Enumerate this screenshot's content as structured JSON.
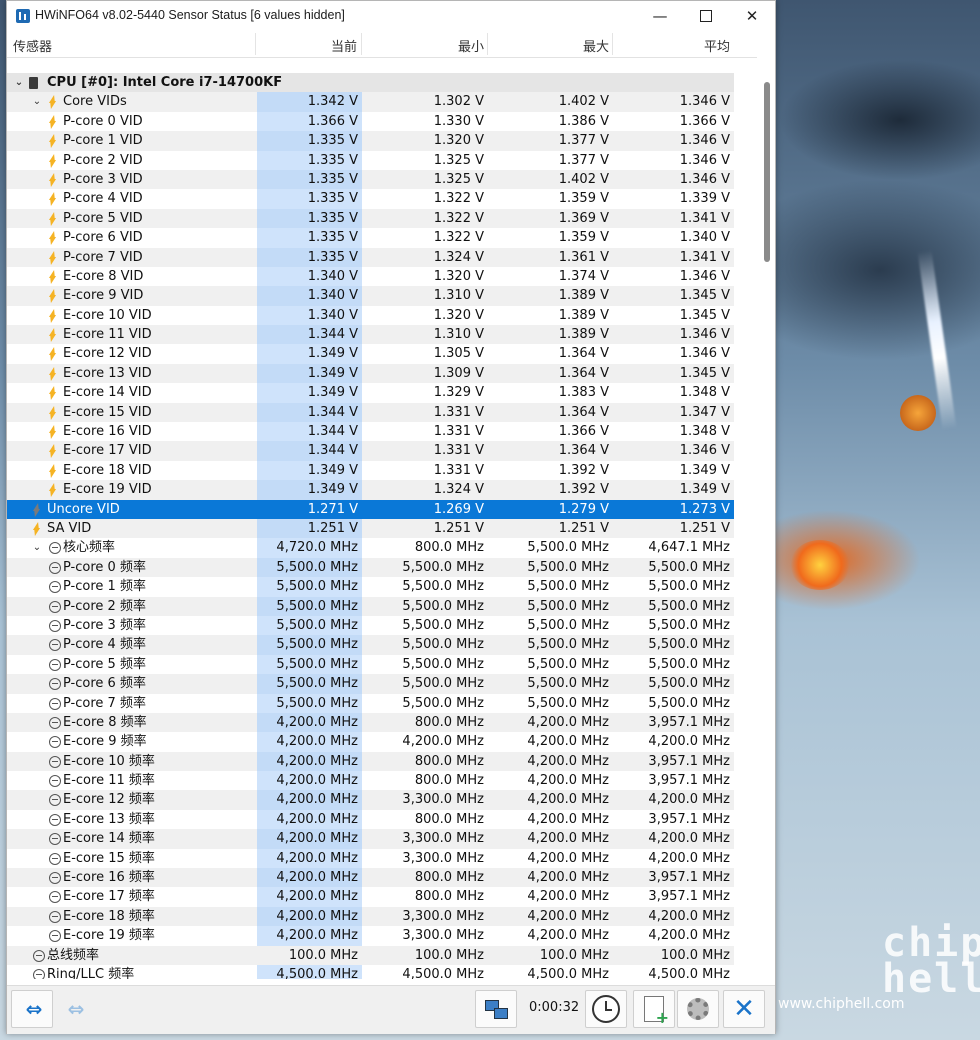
{
  "window": {
    "title": "HWiNFO64 v8.02-5440 Sensor Status [6 values hidden]",
    "minimize_glyph": "—",
    "close_glyph": "✕"
  },
  "columns": {
    "sensor": "传感器",
    "current": "当前",
    "min": "最小",
    "max": "最大",
    "avg": "平均"
  },
  "rows": [
    {
      "type": "group",
      "name": "CPU [#0]: Intel Core i7-14700KF"
    },
    {
      "type": "parent",
      "icon": "voltage-icon",
      "name": "Core VIDs",
      "cur": "1.342 V",
      "min": "1.302 V",
      "max": "1.402 V",
      "avg": "1.346 V"
    },
    {
      "type": "child",
      "icon": "voltage-icon",
      "name": "P-core 0 VID",
      "cur": "1.366 V",
      "min": "1.330 V",
      "max": "1.386 V",
      "avg": "1.366 V"
    },
    {
      "type": "child",
      "icon": "voltage-icon",
      "name": "P-core 1 VID",
      "cur": "1.335 V",
      "min": "1.320 V",
      "max": "1.377 V",
      "avg": "1.346 V"
    },
    {
      "type": "child",
      "icon": "voltage-icon",
      "name": "P-core 2 VID",
      "cur": "1.335 V",
      "min": "1.325 V",
      "max": "1.377 V",
      "avg": "1.346 V"
    },
    {
      "type": "child",
      "icon": "voltage-icon",
      "name": "P-core 3 VID",
      "cur": "1.335 V",
      "min": "1.325 V",
      "max": "1.402 V",
      "avg": "1.346 V"
    },
    {
      "type": "child",
      "icon": "voltage-icon",
      "name": "P-core 4 VID",
      "cur": "1.335 V",
      "min": "1.322 V",
      "max": "1.359 V",
      "avg": "1.339 V"
    },
    {
      "type": "child",
      "icon": "voltage-icon",
      "name": "P-core 5 VID",
      "cur": "1.335 V",
      "min": "1.322 V",
      "max": "1.369 V",
      "avg": "1.341 V"
    },
    {
      "type": "child",
      "icon": "voltage-icon",
      "name": "P-core 6 VID",
      "cur": "1.335 V",
      "min": "1.322 V",
      "max": "1.359 V",
      "avg": "1.340 V"
    },
    {
      "type": "child",
      "icon": "voltage-icon",
      "name": "P-core 7 VID",
      "cur": "1.335 V",
      "min": "1.324 V",
      "max": "1.361 V",
      "avg": "1.341 V"
    },
    {
      "type": "child",
      "icon": "voltage-icon",
      "name": "E-core 8 VID",
      "cur": "1.340 V",
      "min": "1.320 V",
      "max": "1.374 V",
      "avg": "1.346 V"
    },
    {
      "type": "child",
      "icon": "voltage-icon",
      "name": "E-core 9 VID",
      "cur": "1.340 V",
      "min": "1.310 V",
      "max": "1.389 V",
      "avg": "1.345 V"
    },
    {
      "type": "child",
      "icon": "voltage-icon",
      "name": "E-core 10 VID",
      "cur": "1.340 V",
      "min": "1.320 V",
      "max": "1.389 V",
      "avg": "1.345 V"
    },
    {
      "type": "child",
      "icon": "voltage-icon",
      "name": "E-core 11 VID",
      "cur": "1.344 V",
      "min": "1.310 V",
      "max": "1.389 V",
      "avg": "1.346 V"
    },
    {
      "type": "child",
      "icon": "voltage-icon",
      "name": "E-core 12 VID",
      "cur": "1.349 V",
      "min": "1.305 V",
      "max": "1.364 V",
      "avg": "1.346 V"
    },
    {
      "type": "child",
      "icon": "voltage-icon",
      "name": "E-core 13 VID",
      "cur": "1.349 V",
      "min": "1.309 V",
      "max": "1.364 V",
      "avg": "1.345 V"
    },
    {
      "type": "child",
      "icon": "voltage-icon",
      "name": "E-core 14 VID",
      "cur": "1.349 V",
      "min": "1.329 V",
      "max": "1.383 V",
      "avg": "1.348 V"
    },
    {
      "type": "child",
      "icon": "voltage-icon",
      "name": "E-core 15 VID",
      "cur": "1.344 V",
      "min": "1.331 V",
      "max": "1.364 V",
      "avg": "1.347 V"
    },
    {
      "type": "child",
      "icon": "voltage-icon",
      "name": "E-core 16 VID",
      "cur": "1.344 V",
      "min": "1.331 V",
      "max": "1.366 V",
      "avg": "1.348 V"
    },
    {
      "type": "child",
      "icon": "voltage-icon",
      "name": "E-core 17 VID",
      "cur": "1.344 V",
      "min": "1.331 V",
      "max": "1.364 V",
      "avg": "1.346 V"
    },
    {
      "type": "child",
      "icon": "voltage-icon",
      "name": "E-core 18 VID",
      "cur": "1.349 V",
      "min": "1.331 V",
      "max": "1.392 V",
      "avg": "1.349 V"
    },
    {
      "type": "child",
      "icon": "voltage-icon",
      "name": "E-core 19 VID",
      "cur": "1.349 V",
      "min": "1.324 V",
      "max": "1.392 V",
      "avg": "1.349 V"
    },
    {
      "type": "sensor",
      "icon": "voltage-icon",
      "name": "Uncore VID",
      "cur": "1.271 V",
      "min": "1.269 V",
      "max": "1.279 V",
      "avg": "1.273 V",
      "selected": true
    },
    {
      "type": "sensor",
      "icon": "voltage-icon",
      "name": "SA VID",
      "cur": "1.251 V",
      "min": "1.251 V",
      "max": "1.251 V",
      "avg": "1.251 V"
    },
    {
      "type": "parent",
      "icon": "clock-icon",
      "name": "核心频率",
      "cur": "4,720.0 MHz",
      "min": "800.0 MHz",
      "max": "5,500.0 MHz",
      "avg": "4,647.1 MHz"
    },
    {
      "type": "child",
      "icon": "clock-icon",
      "name": "P-core 0 频率",
      "cur": "5,500.0 MHz",
      "min": "5,500.0 MHz",
      "max": "5,500.0 MHz",
      "avg": "5,500.0 MHz"
    },
    {
      "type": "child",
      "icon": "clock-icon",
      "name": "P-core 1 频率",
      "cur": "5,500.0 MHz",
      "min": "5,500.0 MHz",
      "max": "5,500.0 MHz",
      "avg": "5,500.0 MHz"
    },
    {
      "type": "child",
      "icon": "clock-icon",
      "name": "P-core 2 频率",
      "cur": "5,500.0 MHz",
      "min": "5,500.0 MHz",
      "max": "5,500.0 MHz",
      "avg": "5,500.0 MHz"
    },
    {
      "type": "child",
      "icon": "clock-icon",
      "name": "P-core 3 频率",
      "cur": "5,500.0 MHz",
      "min": "5,500.0 MHz",
      "max": "5,500.0 MHz",
      "avg": "5,500.0 MHz"
    },
    {
      "type": "child",
      "icon": "clock-icon",
      "name": "P-core 4 频率",
      "cur": "5,500.0 MHz",
      "min": "5,500.0 MHz",
      "max": "5,500.0 MHz",
      "avg": "5,500.0 MHz"
    },
    {
      "type": "child",
      "icon": "clock-icon",
      "name": "P-core 5 频率",
      "cur": "5,500.0 MHz",
      "min": "5,500.0 MHz",
      "max": "5,500.0 MHz",
      "avg": "5,500.0 MHz"
    },
    {
      "type": "child",
      "icon": "clock-icon",
      "name": "P-core 6 频率",
      "cur": "5,500.0 MHz",
      "min": "5,500.0 MHz",
      "max": "5,500.0 MHz",
      "avg": "5,500.0 MHz"
    },
    {
      "type": "child",
      "icon": "clock-icon",
      "name": "P-core 7 频率",
      "cur": "5,500.0 MHz",
      "min": "5,500.0 MHz",
      "max": "5,500.0 MHz",
      "avg": "5,500.0 MHz"
    },
    {
      "type": "child",
      "icon": "clock-icon",
      "name": "E-core 8 频率",
      "cur": "4,200.0 MHz",
      "min": "800.0 MHz",
      "max": "4,200.0 MHz",
      "avg": "3,957.1 MHz"
    },
    {
      "type": "child",
      "icon": "clock-icon",
      "name": "E-core 9 频率",
      "cur": "4,200.0 MHz",
      "min": "4,200.0 MHz",
      "max": "4,200.0 MHz",
      "avg": "4,200.0 MHz"
    },
    {
      "type": "child",
      "icon": "clock-icon",
      "name": "E-core 10 频率",
      "cur": "4,200.0 MHz",
      "min": "800.0 MHz",
      "max": "4,200.0 MHz",
      "avg": "3,957.1 MHz"
    },
    {
      "type": "child",
      "icon": "clock-icon",
      "name": "E-core 11 频率",
      "cur": "4,200.0 MHz",
      "min": "800.0 MHz",
      "max": "4,200.0 MHz",
      "avg": "3,957.1 MHz"
    },
    {
      "type": "child",
      "icon": "clock-icon",
      "name": "E-core 12 频率",
      "cur": "4,200.0 MHz",
      "min": "3,300.0 MHz",
      "max": "4,200.0 MHz",
      "avg": "4,200.0 MHz"
    },
    {
      "type": "child",
      "icon": "clock-icon",
      "name": "E-core 13 频率",
      "cur": "4,200.0 MHz",
      "min": "800.0 MHz",
      "max": "4,200.0 MHz",
      "avg": "3,957.1 MHz"
    },
    {
      "type": "child",
      "icon": "clock-icon",
      "name": "E-core 14 频率",
      "cur": "4,200.0 MHz",
      "min": "3,300.0 MHz",
      "max": "4,200.0 MHz",
      "avg": "4,200.0 MHz"
    },
    {
      "type": "child",
      "icon": "clock-icon",
      "name": "E-core 15 频率",
      "cur": "4,200.0 MHz",
      "min": "3,300.0 MHz",
      "max": "4,200.0 MHz",
      "avg": "4,200.0 MHz"
    },
    {
      "type": "child",
      "icon": "clock-icon",
      "name": "E-core 16 频率",
      "cur": "4,200.0 MHz",
      "min": "800.0 MHz",
      "max": "4,200.0 MHz",
      "avg": "3,957.1 MHz"
    },
    {
      "type": "child",
      "icon": "clock-icon",
      "name": "E-core 17 频率",
      "cur": "4,200.0 MHz",
      "min": "800.0 MHz",
      "max": "4,200.0 MHz",
      "avg": "3,957.1 MHz"
    },
    {
      "type": "child",
      "icon": "clock-icon",
      "name": "E-core 18 频率",
      "cur": "4,200.0 MHz",
      "min": "3,300.0 MHz",
      "max": "4,200.0 MHz",
      "avg": "4,200.0 MHz"
    },
    {
      "type": "child",
      "icon": "clock-icon",
      "name": "E-core 19 频率",
      "cur": "4,200.0 MHz",
      "min": "3,300.0 MHz",
      "max": "4,200.0 MHz",
      "avg": "4,200.0 MHz"
    },
    {
      "type": "sensor",
      "icon": "clock-icon",
      "name": "总线频率",
      "cur": "100.0 MHz",
      "min": "100.0 MHz",
      "max": "100.0 MHz",
      "avg": "100.0 MHz",
      "plain": true
    },
    {
      "type": "sensor",
      "icon": "clock-icon",
      "name": "Ring/LLC 频率",
      "cur": "4,500.0 MHz",
      "min": "4,500.0 MHz",
      "max": "4,500.0 MHz",
      "avg": "4,500.0 MHz"
    }
  ],
  "footer": {
    "timer": "0:00:32"
  },
  "background": {
    "watermark": "chip hell",
    "watermark_url": "www.chiphell.com"
  },
  "colors": {
    "selection": "#0a78d7",
    "current_column": "#cfe3fb",
    "accent": "#1a73c9"
  }
}
